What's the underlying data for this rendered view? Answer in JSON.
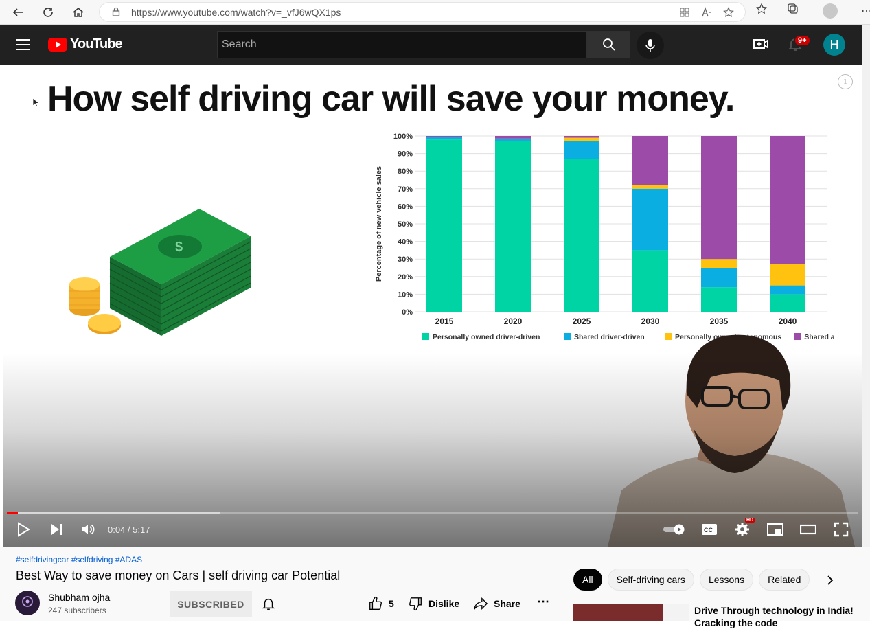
{
  "browser": {
    "url": "https://www.youtube.com/watch?v=_vfJ6wQX1ps"
  },
  "header": {
    "logo_text": "YouTube",
    "search_placeholder": "Search",
    "notif_count": "9+",
    "avatar_letter": "H"
  },
  "video": {
    "slide_title": "How self driving car will save your money.",
    "current_time": "0:04",
    "duration": "5:17",
    "time_display": "0:04 / 5:17",
    "progress_fraction": 0.013,
    "buffered_fraction": 0.25
  },
  "chart_data": {
    "type": "bar",
    "stacked": true,
    "ylabel": "Percentage of new vehicle sales",
    "xlabel": "",
    "ylim": [
      0,
      100
    ],
    "ytick_labels": [
      "0%",
      "10%",
      "20%",
      "30%",
      "40%",
      "50%",
      "60%",
      "70%",
      "80%",
      "90%",
      "100%"
    ],
    "categories": [
      "2015",
      "2020",
      "2025",
      "2030",
      "2035",
      "2040"
    ],
    "series": [
      {
        "name": "Personally owned driver-driven",
        "color": "#00d4a4",
        "values": [
          98,
          97,
          87,
          35,
          14,
          10
        ]
      },
      {
        "name": "Shared driver-driven",
        "color": "#0aaee0",
        "values": [
          1.5,
          1.5,
          10,
          35,
          11,
          5
        ]
      },
      {
        "name": "Personally owned autonomous",
        "color": "#ffc20e",
        "values": [
          0,
          0,
          2,
          2,
          5,
          12
        ]
      },
      {
        "name": "Shared autonomous",
        "color": "#9c4ca8",
        "values": [
          0.5,
          1.5,
          1,
          28,
          70,
          73
        ]
      }
    ],
    "legend_position": "bottom"
  },
  "details": {
    "hashtags": "#selfdrivingcar #selfdriving #ADAS",
    "title": "Best Way to save money on Cars | self driving car Potential",
    "channel": "Shubham ojha",
    "subscribers": "247 subscribers",
    "subscribe_label": "SUBSCRIBED",
    "like_count": "5",
    "dislike_label": "Dislike",
    "share_label": "Share"
  },
  "chips": [
    "All",
    "Self-driving cars",
    "Lessons",
    "Related"
  ],
  "recommended": {
    "title": "Drive Through technology in India! Cracking the code"
  }
}
